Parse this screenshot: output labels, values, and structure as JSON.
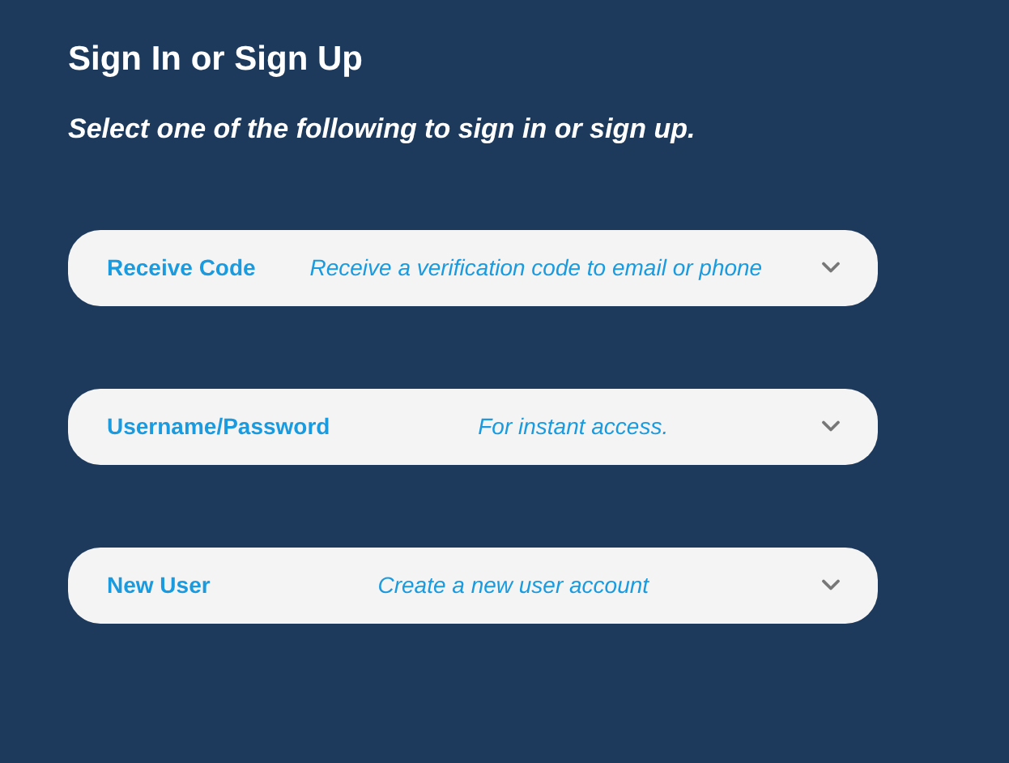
{
  "title": "Sign In or Sign Up",
  "subtitle": "Select one of the following to sign in or sign up.",
  "options": [
    {
      "label": "Receive Code",
      "description": "Receive a verification code to email or phone",
      "expanded": false
    },
    {
      "label": "Username/Password",
      "description": "For instant access.",
      "expanded": false
    },
    {
      "label": "New User",
      "description": "Create a new user account",
      "expanded": false
    }
  ]
}
